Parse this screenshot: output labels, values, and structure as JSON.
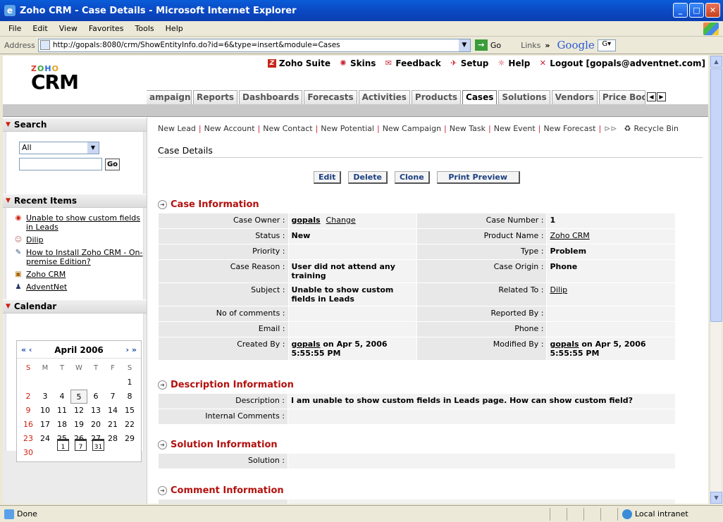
{
  "window": {
    "title": "Zoho CRM - Case Details - Microsoft Internet Explorer",
    "minimize": "_",
    "maximize": "□",
    "close": "✕"
  },
  "menu": [
    "File",
    "Edit",
    "View",
    "Favorites",
    "Tools",
    "Help"
  ],
  "address": {
    "label": "Address",
    "url": "http://gopals:8080/crm/ShowEntityInfo.do?id=6&type=insert&module=Cases",
    "go": "Go",
    "links": "Links",
    "chevron": "»",
    "google": "Google",
    "gbox": "G▾"
  },
  "header": {
    "logo_zoho": [
      "Z",
      "O",
      "H",
      "O"
    ],
    "logo_crm": "CRM",
    "toplinks": [
      {
        "icon": "Z",
        "label": "Zoho Suite"
      },
      {
        "icon": "✺",
        "label": "Skins"
      },
      {
        "icon": "✉",
        "label": "Feedback"
      },
      {
        "icon": "✈",
        "label": "Setup"
      },
      {
        "icon": "☼",
        "label": "Help"
      },
      {
        "icon": "✕",
        "label": "Logout [gopals@adventnet.com]"
      }
    ]
  },
  "tabs": [
    "ampaigns",
    "Reports",
    "Dashboards",
    "Forecasts",
    "Activities",
    "Products",
    "Cases",
    "Solutions",
    "Vendors",
    "Price Boo"
  ],
  "tab_nav": [
    "◀",
    "▶"
  ],
  "sidebar": {
    "search": {
      "title": "Search",
      "select": "All",
      "go": "Go"
    },
    "recent": {
      "title": "Recent Items",
      "items": [
        {
          "icon": "case",
          "label": "Unable to show custom fields in Leads"
        },
        {
          "icon": "contact",
          "label": "Dilip"
        },
        {
          "icon": "solution",
          "label": "How to Install Zoho CRM - On-premise Edition?"
        },
        {
          "icon": "product",
          "label": "Zoho CRM"
        },
        {
          "icon": "account",
          "label": "AdventNet"
        }
      ]
    },
    "calendar": {
      "title": "Calendar",
      "month": "April 2006",
      "prev": "« ‹",
      "next": "› »",
      "days": [
        "S",
        "M",
        "T",
        "W",
        "T",
        "F",
        "S"
      ],
      "dates": [
        "",
        "",
        "",
        "",
        "",
        "",
        "1",
        "2",
        "3",
        "4",
        "5",
        "6",
        "7",
        "8",
        "9",
        "10",
        "11",
        "12",
        "13",
        "14",
        "15",
        "16",
        "17",
        "18",
        "19",
        "20",
        "21",
        "22",
        "23",
        "24",
        "25",
        "26",
        "27",
        "28",
        "29",
        "30"
      ],
      "today": "5",
      "views": [
        "1",
        "7",
        "31"
      ]
    }
  },
  "newbar": [
    "New Lead",
    "New Account",
    "New Contact",
    "New Potential",
    "New Campaign",
    "New Task",
    "New Event",
    "New Forecast"
  ],
  "newbar_more": "⊳⊳",
  "recycle": "Recycle Bin",
  "page_title": "Case Details",
  "buttons": {
    "edit": "Edit",
    "delete": "Delete",
    "clone": "Clone",
    "print": "Print Preview"
  },
  "case_info": {
    "title": "Case Information",
    "rows": [
      {
        "l1": "Case Owner :",
        "v1": "gopals",
        "v1b": "Change",
        "l2": "Case Number :",
        "v2": "1"
      },
      {
        "l1": "Status :",
        "v1": "New",
        "l2": "Product Name :",
        "v2": "Zoho CRM"
      },
      {
        "l1": "Priority :",
        "v1": "",
        "l2": "Type :",
        "v2": "Problem"
      },
      {
        "l1": "Case Reason :",
        "v1": "User did not attend any training",
        "l2": "Case Origin :",
        "v2": "Phone"
      },
      {
        "l1": "Subject :",
        "v1": "Unable to show custom fields in Leads",
        "l2": "Related To :",
        "v2": "Dilip"
      },
      {
        "l1": "No of comments :",
        "v1": "",
        "l2": "Reported By :",
        "v2": ""
      },
      {
        "l1": "Email :",
        "v1": "",
        "l2": "Phone :",
        "v2": ""
      },
      {
        "l1": "Created By :",
        "v1": "gopals",
        "v1c": " on Apr 5, 2006 5:55:55 PM",
        "l2": "Modified By :",
        "v2": "gopals",
        "v2c": " on Apr 5, 2006 5:55:55 PM"
      }
    ]
  },
  "desc_info": {
    "title": "Description Information",
    "rows": [
      {
        "l": "Description :",
        "v": "I am unable to show custom fields in Leads page. How can show custom field?"
      },
      {
        "l": "Internal Comments :",
        "v": ""
      }
    ]
  },
  "solution_info": {
    "title": "Solution Information",
    "rows": [
      {
        "l": "Solution :",
        "v": ""
      }
    ]
  },
  "comment_info": {
    "title": "Comment Information"
  },
  "status": {
    "text": "Done",
    "zone": "Local intranet"
  }
}
